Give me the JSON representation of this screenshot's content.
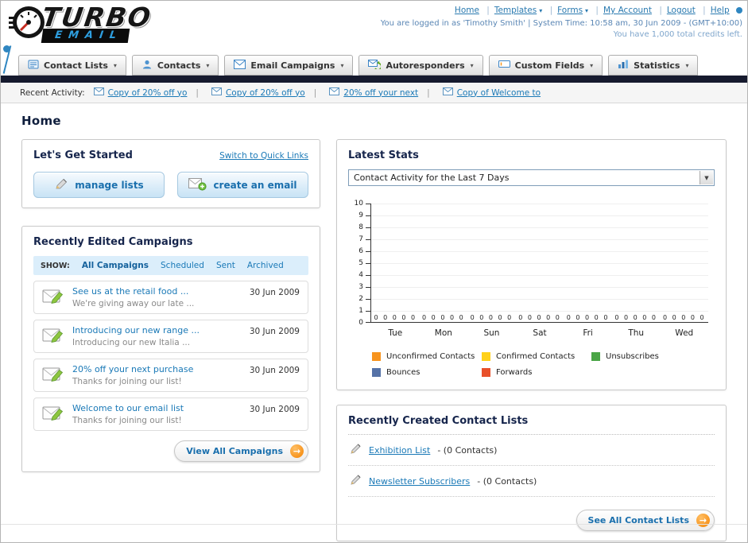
{
  "header": {
    "logo_title": "TURBO",
    "logo_subtitle": "EMAIL",
    "nav_links": [
      {
        "label": "Home",
        "has_dropdown": false
      },
      {
        "label": "Templates",
        "has_dropdown": true
      },
      {
        "label": "Forms",
        "has_dropdown": true
      },
      {
        "label": "My Account",
        "has_dropdown": false
      },
      {
        "label": "Logout",
        "has_dropdown": false
      },
      {
        "label": "Help",
        "has_dropdown": false
      }
    ],
    "login_info": "You are logged in as 'Timothy Smith' | System Time: 10:58 am, 30 Jun 2009 - (GMT+10:00)",
    "credits_info": "You have 1,000 total credits left."
  },
  "nav_tabs": [
    {
      "label": "Contact Lists",
      "icon": "contact-lists-icon"
    },
    {
      "label": "Contacts",
      "icon": "contacts-icon"
    },
    {
      "label": "Email Campaigns",
      "icon": "email-campaigns-icon"
    },
    {
      "label": "Autoresponders",
      "icon": "autoresponders-icon"
    },
    {
      "label": "Custom Fields",
      "icon": "custom-fields-icon"
    },
    {
      "label": "Statistics",
      "icon": "statistics-icon"
    }
  ],
  "recent_activity": {
    "label": "Recent Activity:",
    "items": [
      "Copy of 20% off yo",
      "Copy of 20% off yo",
      "20% off your next",
      "Copy of Welcome to"
    ]
  },
  "page_title": "Home",
  "get_started": {
    "title": "Let's Get Started",
    "switch_link": "Switch to Quick Links",
    "manage_lists_label": "manage lists",
    "create_email_label": "create an email"
  },
  "campaigns_panel": {
    "title": "Recently Edited Campaigns",
    "show_label": "SHOW:",
    "tabs": [
      "All Campaigns",
      "Scheduled",
      "Sent",
      "Archived"
    ],
    "active_tab": "All Campaigns",
    "items": [
      {
        "title": "See us at the retail food ...",
        "subtitle": "We're giving away our late ...",
        "date": "30 Jun 2009"
      },
      {
        "title": "Introducing our new range ...",
        "subtitle": "Introducing our new Italia ...",
        "date": "30 Jun 2009"
      },
      {
        "title": "20% off your next purchase",
        "subtitle": "Thanks for joining our list!",
        "date": "30 Jun 2009"
      },
      {
        "title": "Welcome to our email list",
        "subtitle": "Thanks for joining our list!",
        "date": "30 Jun 2009"
      }
    ],
    "view_all_label": "View All Campaigns"
  },
  "stats_panel": {
    "title": "Latest Stats",
    "filter_value": "Contact Activity for the Last 7 Days"
  },
  "chart_data": {
    "type": "bar",
    "title": "Contact Activity for the Last 7 Days",
    "categories": [
      "Tue",
      "Mon",
      "Sun",
      "Sat",
      "Fri",
      "Thu",
      "Wed"
    ],
    "series": [
      {
        "name": "Unconfirmed Contacts",
        "color": "#f7941e",
        "values": [
          0,
          0,
          0,
          0,
          0,
          0,
          0
        ]
      },
      {
        "name": "Confirmed Contacts",
        "color": "#ffd11a",
        "values": [
          0,
          0,
          0,
          0,
          0,
          0,
          0
        ]
      },
      {
        "name": "Unsubscribes",
        "color": "#4aa546",
        "values": [
          0,
          0,
          0,
          0,
          0,
          0,
          0
        ]
      },
      {
        "name": "Bounces",
        "color": "#5572a7",
        "values": [
          0,
          0,
          0,
          0,
          0,
          0,
          0
        ]
      },
      {
        "name": "Forwards",
        "color": "#e8502a",
        "values": [
          0,
          0,
          0,
          0,
          0,
          0,
          0
        ]
      }
    ],
    "ylim": [
      0,
      10
    ],
    "yticks": [
      0,
      1,
      2,
      3,
      4,
      5,
      6,
      7,
      8,
      9,
      10
    ],
    "grid": true,
    "legend_position": "bottom",
    "show_value_labels": true
  },
  "contact_lists_panel": {
    "title": "Recently Created Contact Lists",
    "items": [
      {
        "name": "Exhibition List",
        "detail": "- (0 Contacts)"
      },
      {
        "name": "Newsletter Subscribers",
        "detail": "- (0 Contacts)"
      }
    ],
    "see_all_label": "See All Contact Lists"
  },
  "colors": {
    "link_blue": "#1a79b7",
    "accent_orange": "#f7941e",
    "dark_bar": "#161a2e"
  }
}
